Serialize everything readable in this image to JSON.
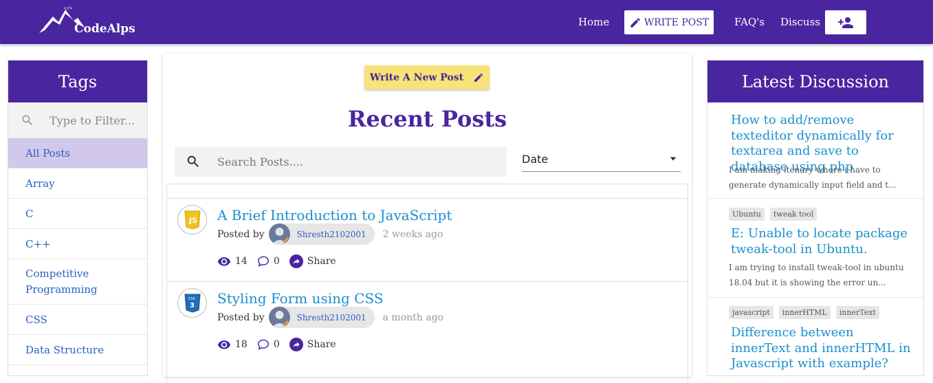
{
  "navbar": {
    "logo_text": "CodeAlps",
    "home": "Home",
    "write_post": "WRITE POST",
    "faqs": "FAQ's",
    "discuss": "Discuss"
  },
  "tags": {
    "title": "Tags",
    "filter_placeholder": "Type to Filter...",
    "items": [
      "All Posts",
      "Array",
      "C",
      "C++",
      "Competitive Programming",
      "CSS",
      "Data Structure"
    ]
  },
  "center": {
    "write_new_label": "Write A New Post",
    "title": "Recent Posts",
    "search_placeholder": "Search Posts....",
    "sort_value": "Date",
    "posted_by_label": "Posted by",
    "share_label": "Share",
    "posts": [
      {
        "icon": "javascript-icon",
        "title": "A Brief Introduction to JavaScript",
        "author": "Shresth2102001",
        "time": "2 weeks ago",
        "views": "14",
        "comments": "0"
      },
      {
        "icon": "css3-icon",
        "title": "Styling Form using CSS",
        "author": "Shresth2102001",
        "time": "a month ago",
        "views": "18",
        "comments": "0"
      }
    ]
  },
  "discussion": {
    "title": "Latest Discussion",
    "items": [
      {
        "tags": [],
        "title": "How to add/remove texteditor dynamically for textarea and save to database using php",
        "body": "I am making itenary where i have to generate dynamically input field and t..."
      },
      {
        "tags": [
          "Ubuntu",
          "tweak tool"
        ],
        "title": "E: Unable to locate package tweak-tool in Ubuntu.",
        "body": "I am trying to install tweak-tool in ubuntu 18.04 but it is showing the error un..."
      },
      {
        "tags": [
          "javascript",
          "innerHTML",
          "innerText"
        ],
        "title": "Difference between innerText and innerHTML in Javascript with example?",
        "body": ""
      }
    ]
  },
  "colors": {
    "brand": "#4a25a0",
    "accent_yellow": "#f8e27a",
    "link": "#1a8fd0",
    "active_tag_bg": "#d2c8ec"
  }
}
